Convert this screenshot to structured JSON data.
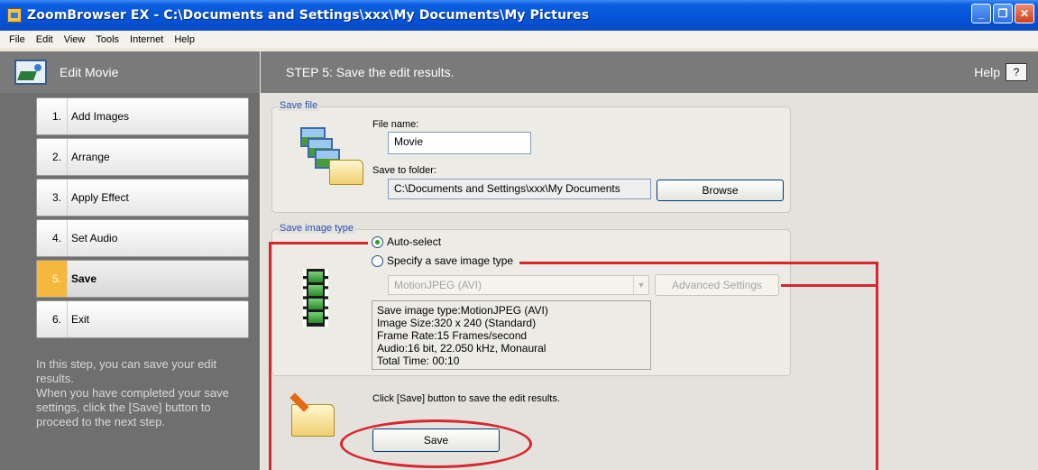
{
  "window": {
    "title": "ZoomBrowser EX  -  C:\\Documents and Settings\\xxx\\My Documents\\My Pictures"
  },
  "menu": [
    "File",
    "Edit",
    "View",
    "Tools",
    "Internet",
    "Help"
  ],
  "sidebar": {
    "title": "Edit Movie",
    "steps": [
      {
        "num": "1.",
        "label": "Add Images"
      },
      {
        "num": "2.",
        "label": "Arrange"
      },
      {
        "num": "3.",
        "label": "Apply Effect"
      },
      {
        "num": "4.",
        "label": "Set Audio"
      },
      {
        "num": "5.",
        "label": "Save"
      },
      {
        "num": "6.",
        "label": "Exit"
      }
    ],
    "active_step": 5,
    "help_text": "In this step, you can save your edit results.\n When you have completed your save settings, click the [Save] button to proceed to the next step."
  },
  "main": {
    "header": "STEP 5: Save the edit results.",
    "help_label": "Help",
    "help_button": "?",
    "save_file": {
      "legend": "Save file",
      "file_name_label": "File name:",
      "file_name_value": "Movie",
      "folder_label": "Save to folder:",
      "folder_value": "C:\\Documents and Settings\\xxx\\My Documents",
      "browse_label": "Browse"
    },
    "save_image_type": {
      "legend": "Save image type",
      "auto_select_label": "Auto-select",
      "specify_label": "Specify a save image type",
      "selected_option": "auto-select",
      "type_select_value": "MotionJPEG (AVI)",
      "advanced_label": "Advanced Settings",
      "info": "Save image type:MotionJPEG (AVI)\nImage Size:320 x 240 (Standard)\nFrame Rate:15 Frames/second\nAudio:16 bit, 22.050 kHz, Monaural\nTotal Time: 00:10"
    },
    "save_section": {
      "instruction": "Click [Save] button to save the edit results.",
      "save_label": "Save"
    }
  },
  "colors": {
    "annotation": "#d9262e",
    "active_step": "#f5b83d",
    "panel_header": "#7a7a7a"
  }
}
